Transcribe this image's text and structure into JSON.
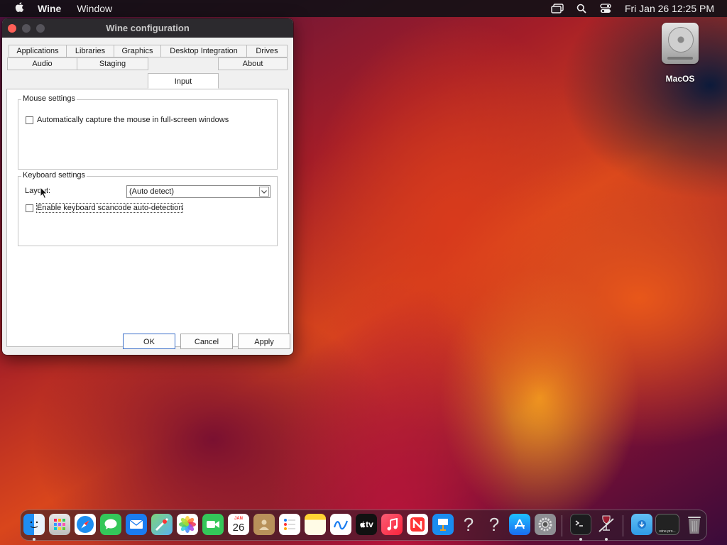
{
  "menubar": {
    "app_name": "Wine",
    "menu_window": "Window",
    "clock": "Fri Jan 26  12:25 PM"
  },
  "desktop": {
    "disk_label": "MacOS"
  },
  "window": {
    "title": "Wine configuration",
    "tabs_row1": [
      "Applications",
      "Libraries",
      "Graphics",
      "Desktop Integration",
      "Drives"
    ],
    "tabs_row2": [
      "Audio",
      "Staging",
      "Input",
      "About"
    ],
    "active_tab": "Input",
    "mouse_group": {
      "legend": "Mouse settings",
      "capture_label": "Automatically capture the mouse in full-screen windows",
      "capture_checked": false
    },
    "keyboard_group": {
      "legend": "Keyboard settings",
      "layout_label": "Layout:",
      "layout_value": "(Auto detect)",
      "scancode_label": "Enable keyboard scancode auto-detection",
      "scancode_checked": false
    },
    "buttons": {
      "ok": "OK",
      "cancel": "Cancel",
      "apply": "Apply"
    }
  },
  "dock": {
    "calendar_month": "JAN",
    "calendar_day": "26",
    "tv_label": "tv",
    "help_glyph": "?",
    "window_label": "wine-pro..."
  },
  "colors": {
    "close": "#ff5f57",
    "default_button_border": "#3b6fc9"
  }
}
